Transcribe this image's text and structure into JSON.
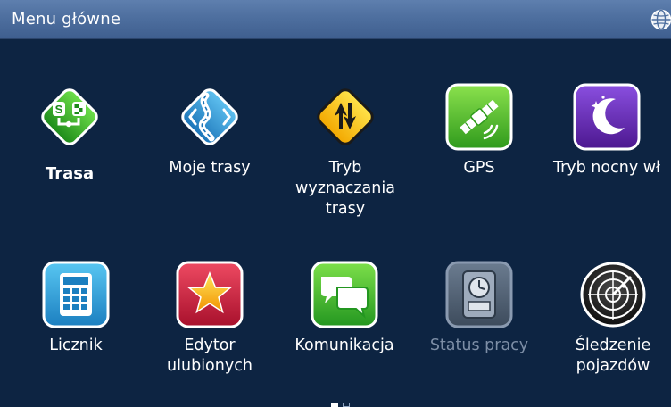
{
  "header": {
    "title": "Menu główne",
    "globe_icon": "globe-icon"
  },
  "tiles": [
    {
      "label": "Trasa",
      "icon": "route-icon",
      "enabled": true,
      "bold": true
    },
    {
      "label": "Moje trasy",
      "icon": "road-curve-icon",
      "enabled": true
    },
    {
      "label": "Tryb\nwyznaczania\ntrasy",
      "icon": "road-sign-icon",
      "enabled": true
    },
    {
      "label": "GPS",
      "icon": "satellite-icon",
      "enabled": true
    },
    {
      "label": "Tryb nocny wł",
      "icon": "night-mode-icon",
      "enabled": true
    },
    {
      "label": "Licznik",
      "icon": "calculator-icon",
      "enabled": true
    },
    {
      "label": "Edytor\nulubionych",
      "icon": "favorite-star-icon",
      "enabled": true
    },
    {
      "label": "Komunikacja",
      "icon": "chat-icon",
      "enabled": true
    },
    {
      "label": "Status pracy",
      "icon": "time-clock-icon",
      "enabled": false
    },
    {
      "label": "Śledzenie\npojazdów",
      "icon": "radar-icon",
      "enabled": true
    }
  ],
  "pager": {
    "current_page": 1,
    "page_count": 2
  },
  "colors": {
    "background": "#0d2442",
    "header": "#4e6f9f",
    "label_text": "#ffffff",
    "disabled_text": "#7d8ea6"
  }
}
